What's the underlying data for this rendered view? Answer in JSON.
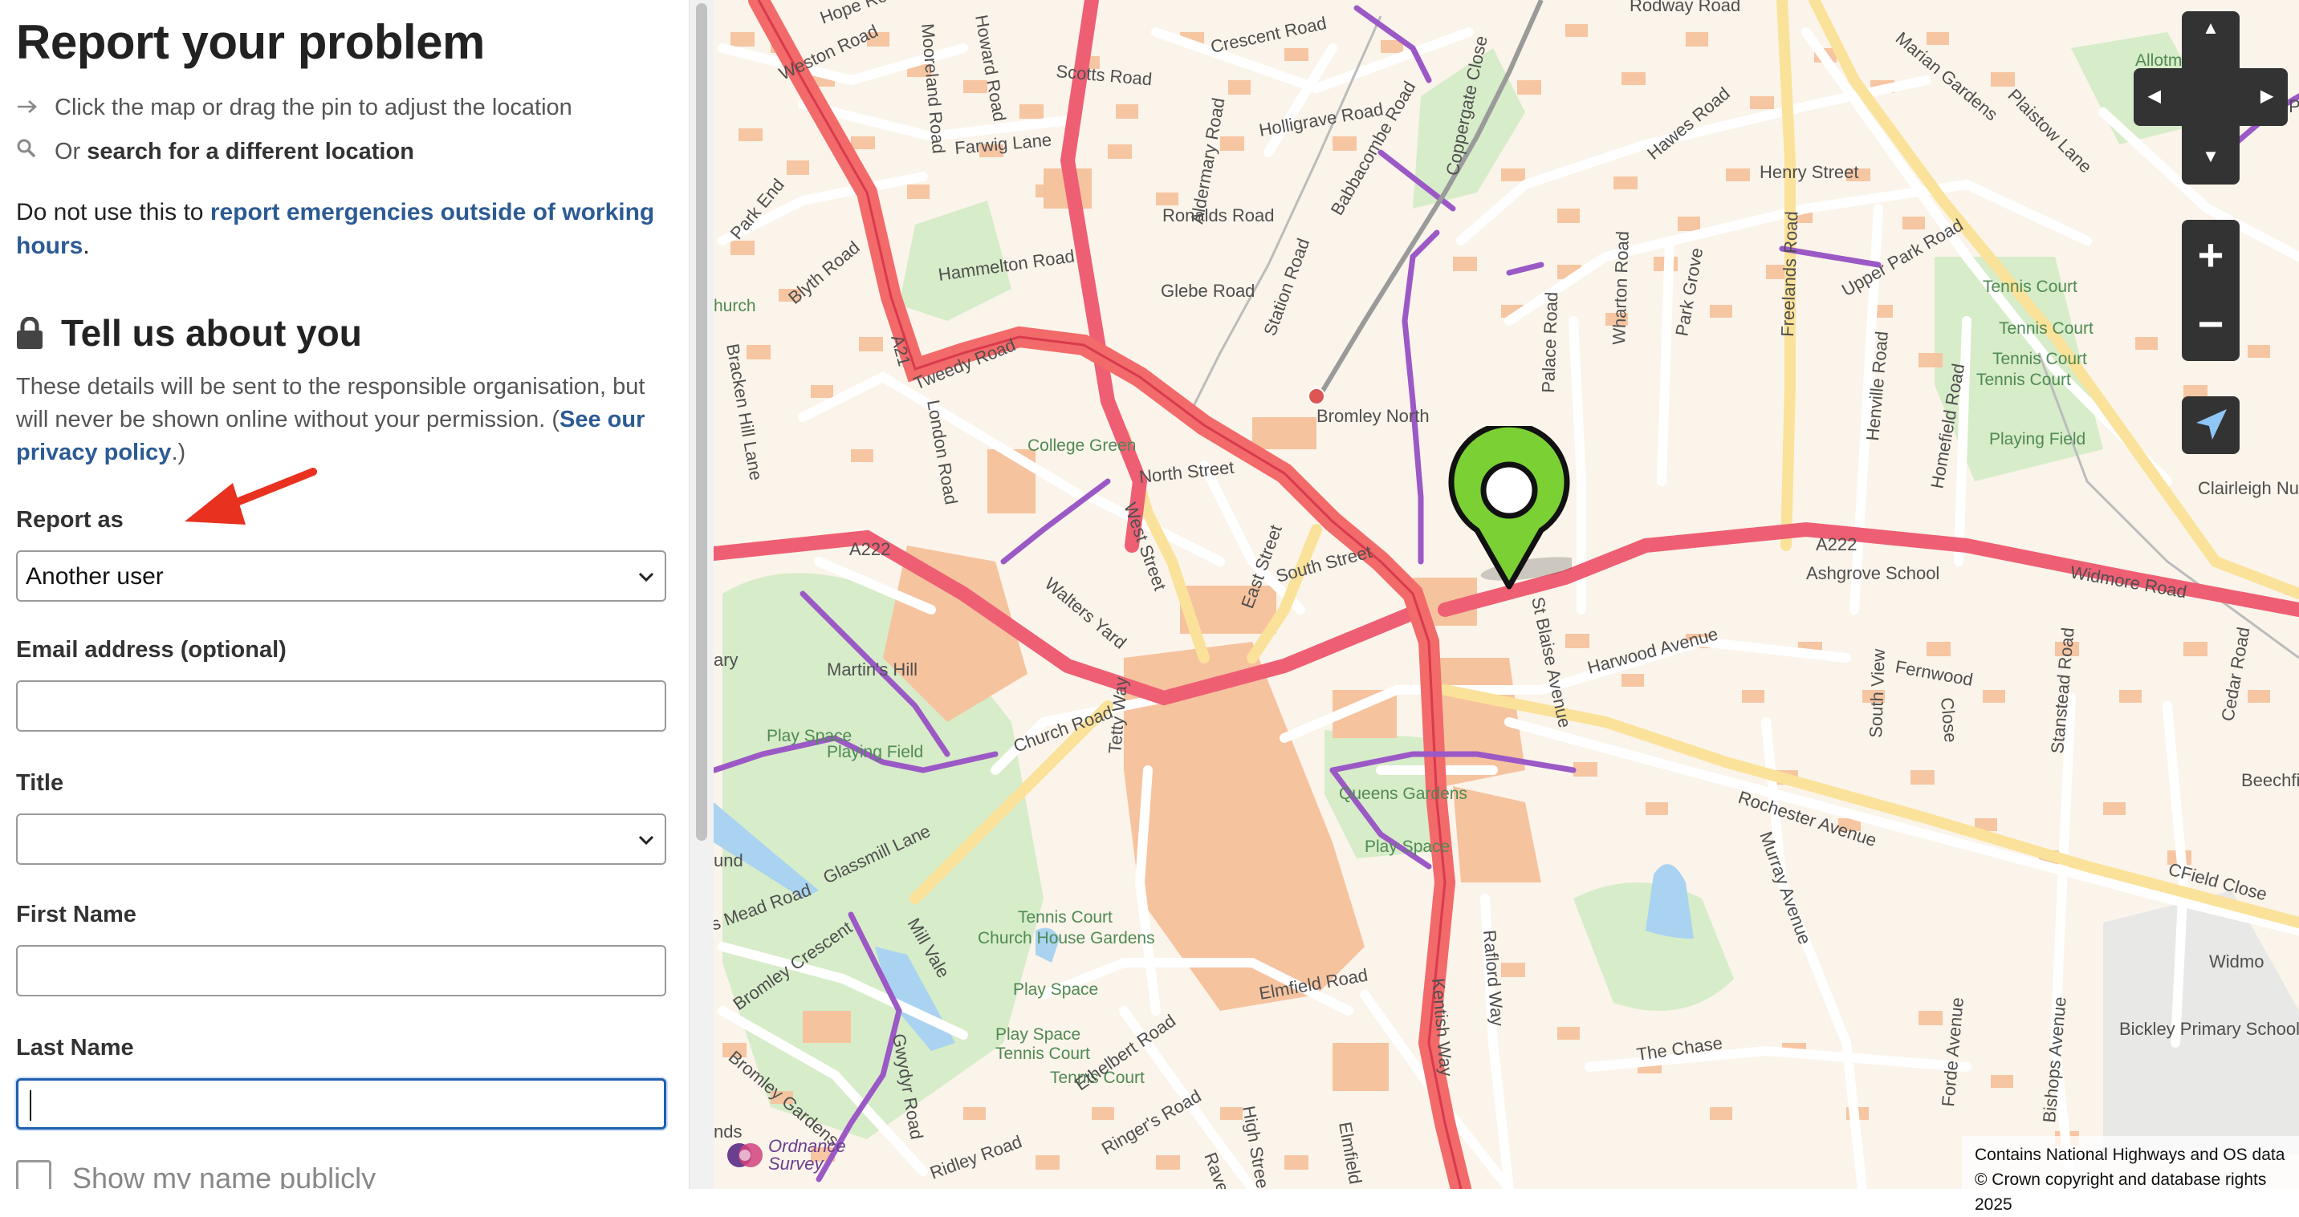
{
  "sidebar": {
    "heading": "Report your problem",
    "hint_adjust": "Click the map or drag the pin to adjust the location",
    "hint_search_prefix": "Or",
    "hint_search_link": "search for a different location",
    "notice_prefix": "Do not use this to",
    "notice_link": "report emergencies outside of working hours",
    "notice_suffix": ".",
    "section_heading": "Tell us about you",
    "section_desc": "These details will be sent to the responsible organisation, but will never be shown online without your permission.",
    "privacy_open": "(",
    "privacy_link": "See our privacy policy",
    "privacy_close": ".)",
    "report_as_label": "Report as",
    "report_as_value": "Another user",
    "email_label": "Email address (optional)",
    "email_value": "",
    "title_label": "Title",
    "title_value": "",
    "first_name_label": "First Name",
    "first_name_value": "",
    "last_name_label": "Last Name",
    "last_name_value": "",
    "show_name_label": "Show my name publicly"
  },
  "map": {
    "labels": {
      "hope_road": "Hope Road",
      "weston_road": "Weston Road",
      "howard_road": "Howard Road",
      "mooreland_road": "Mooreland Road",
      "scotts_road": "Scotts Road",
      "crescent_road": "Crescent Road",
      "rodway_road": "Rodway Road",
      "holligrave_road": "Holligrave Road",
      "farwig_lane": "Farwig Lane",
      "park_end": "Park End",
      "hammelton_road": "Hammelton Road",
      "aldermary_road": "Aldermary Road",
      "babbacombe_road": "Babbacombe Road",
      "coppergate_close": "Coppergate Close",
      "hawes_road": "Hawes Road",
      "henry_street": "Henry Street",
      "marian_gardens": "Marian Gardens",
      "plaistow_lane": "Plaistow Lane",
      "allotments": "Allotments",
      "scots_park": "Scots Pa",
      "ronalds_road": "Ronalds Road",
      "blyth_road": "Blyth Road",
      "glebe_road": "Glebe Road",
      "station_road": "Station Road",
      "church": "hurch",
      "tweedy_road": "Tweedy Road",
      "a21": "A21",
      "london_road": "London Road",
      "bracken_hill_lane": "Bracken Hill Lane",
      "bromley_north": "Bromley North",
      "college_green": "College Green",
      "north_street": "North Street",
      "west_street": "West Street",
      "walters_yard": "Walters Yard",
      "east_street": "East Street",
      "south_street": "South Street",
      "a222_left": "A222",
      "a222_right": "A222",
      "freelands_road": "Freelands Road",
      "palace_road": "Palace Road",
      "wharton_road": "Wharton Road",
      "park_grove": "Park Grove",
      "upper_park_road": "Upper Park Road",
      "tennis_court_1": "Tennis Court",
      "tennis_court_2": "Tennis Court",
      "tennis_court_3": "Tennis Court",
      "tennis_court_4": "Tennis Court",
      "playing_field": "Playing Field",
      "henville_road": "Henville Road",
      "homefield_road": "Homefield Road",
      "clairleigh_nursing_home": "Clairleigh Nursing Home",
      "ashgrove_school": "Ashgrove School",
      "widmore_road": "Widmore Road",
      "st_blaise_avenue": "St Blaise Avenue",
      "harwood_avenue": "Harwood Avenue",
      "fernwood": "Fernwood",
      "south_view": "South View",
      "close": "Close",
      "stanstead_road": "Stanstead Road",
      "cedar_road": "Cedar Road",
      "beechfi": "Beechfi",
      "martins_hill": "Martin's Hill",
      "ary": "ary",
      "play_space_1": "Play Space",
      "playing_field_2": "Playing Field",
      "church_road": "Church Road",
      "tetty_way": "Tetty Way",
      "queens_gardens": "Queens Gardens",
      "play_space_2": "Play Space",
      "rochester_avenue": "Rochester Avenue",
      "murray_avenue": "Murray Avenue",
      "cfield_close": "CField Close",
      "glassmill_lane": "Glassmill Lane",
      "mead_road": "s Mead Road",
      "mill_vale": "Mill Vale",
      "tennis_court_5": "Tennis Court",
      "church_house_gardens": "Church House Gardens",
      "play_space_3": "Play Space",
      "play_space_4": "Play Space",
      "tennis_court_6": "Tennis Court",
      "tennis_court_7": "Tennis Court",
      "raflord_way": "Raflord Way",
      "widmo": "Widmo",
      "bromley_crescent": "Bromley Crescent",
      "gwydyr_road": "Gwydyr Road",
      "bromley_gardens": "Bromley Gardens",
      "ethelbert_road": "Ethelbert Road",
      "elmfield_road": "Elmfield Road",
      "kentish_way": "Kentish Way",
      "the_chase": "The Chase",
      "forde_avenue": "Forde Avenue",
      "bishops_avenue": "Bishops Avenue",
      "bickley_primary_school": "Bickley Primary School",
      "ringers_road": "Ringer's Road",
      "high_street": "High Stree",
      "ridley_road": "Ridley Road",
      "ravensbourne": "Rave",
      "elmfield": "Elmfield",
      "und": "und",
      "nds": "nds"
    },
    "attribution_line1": "Contains National Highways and OS data",
    "attribution_line2": "© Crown copyright and database rights 2025",
    "os_logo_line1": "Ordnance",
    "os_logo_line2": "Survey",
    "colors": {
      "background": "#fbf4ea",
      "building": "#f6c39f",
      "major_road": "#ee5f74",
      "red_route": "#f26a6a",
      "secondary_road": "#fbe29a",
      "park": "#d7ecc9",
      "path": "#9b59c6",
      "pin": "#7bd033"
    },
    "controls": {
      "pan_up": "▲",
      "pan_down": "▼",
      "pan_left": "◀",
      "pan_right": "▶",
      "zoom_in": "+",
      "zoom_out": "−"
    }
  }
}
